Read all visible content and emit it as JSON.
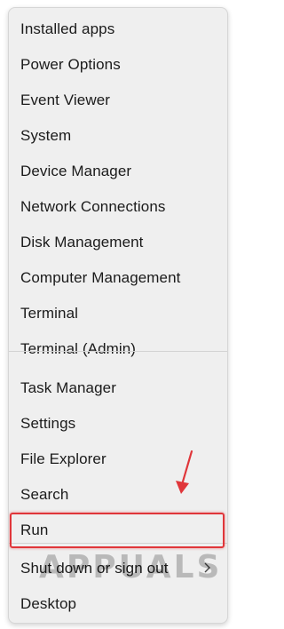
{
  "menu": {
    "items": [
      {
        "label": "Installed apps"
      },
      {
        "label": "Power Options"
      },
      {
        "label": "Event Viewer"
      },
      {
        "label": "System"
      },
      {
        "label": "Device Manager"
      },
      {
        "label": "Network Connections"
      },
      {
        "label": "Disk Management"
      },
      {
        "label": "Computer Management"
      },
      {
        "label": "Terminal"
      },
      {
        "label": "Terminal (Admin)"
      },
      {
        "label": "Task Manager"
      },
      {
        "label": "Settings"
      },
      {
        "label": "File Explorer"
      },
      {
        "label": "Search"
      },
      {
        "label": "Run"
      },
      {
        "label": "Shut down or sign out"
      },
      {
        "label": "Desktop"
      }
    ],
    "submenu_icon": "chevron-right-icon"
  },
  "annotation": {
    "highlight_color": "#e0363a",
    "arrow_color": "#e0363a"
  },
  "watermark": {
    "text": "APPUALS"
  }
}
